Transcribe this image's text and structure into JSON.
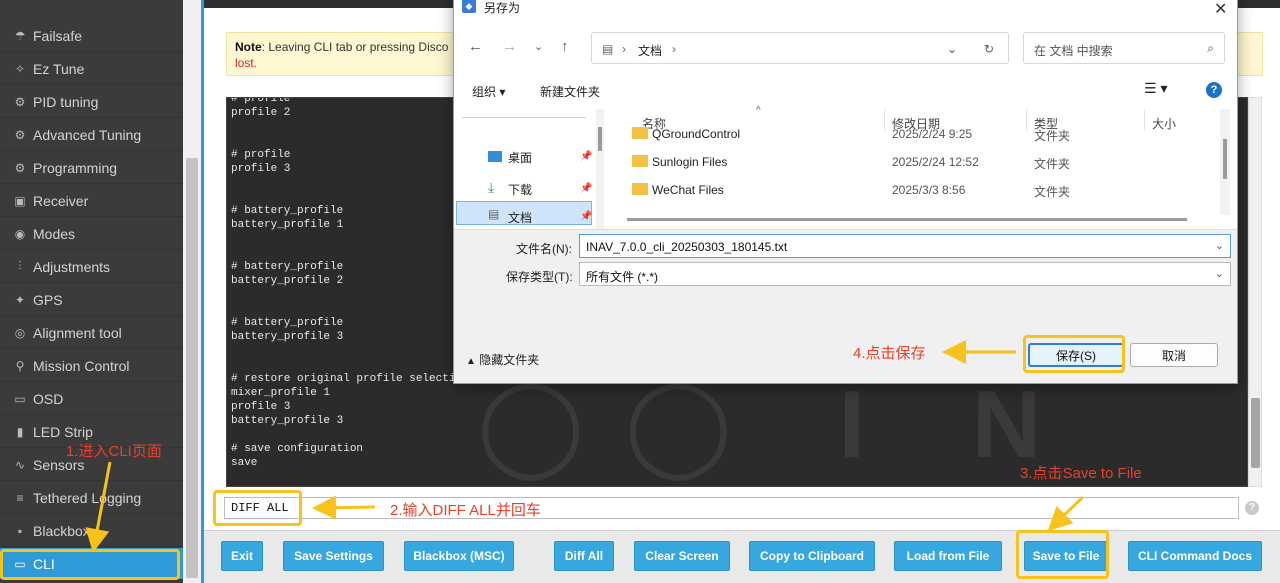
{
  "sidebar": {
    "items": [
      {
        "label": "Failsafe",
        "icon": "parachute-icon"
      },
      {
        "label": "Ez Tune",
        "icon": "magic-wand-icon"
      },
      {
        "label": "PID tuning",
        "icon": "pid-icon"
      },
      {
        "label": "Advanced Tuning",
        "icon": "advanced-tuning-icon"
      },
      {
        "label": "Programming",
        "icon": "gear-icon"
      },
      {
        "label": "Receiver",
        "icon": "receiver-icon"
      },
      {
        "label": "Modes",
        "icon": "toggle-icon"
      },
      {
        "label": "Adjustments",
        "icon": "sliders-icon"
      },
      {
        "label": "GPS",
        "icon": "satellite-icon"
      },
      {
        "label": "Alignment tool",
        "icon": "compass-icon"
      },
      {
        "label": "Mission Control",
        "icon": "map-pin-icon"
      },
      {
        "label": "OSD",
        "icon": "osd-icon"
      },
      {
        "label": "LED Strip",
        "icon": "led-icon"
      },
      {
        "label": "Sensors",
        "icon": "pulse-icon"
      },
      {
        "label": "Tethered Logging",
        "icon": "log-icon"
      },
      {
        "label": "Blackbox",
        "icon": "blackbox-icon"
      },
      {
        "label": "CLI",
        "icon": "terminal-icon"
      }
    ]
  },
  "note": {
    "bold": "Note",
    "text": ": Leaving CLI tab or pressing Disco",
    "lost": "lost."
  },
  "console": {
    "lines": [
      "# profile",
      "profile 2",
      "",
      "",
      "# profile",
      "profile 3",
      "",
      "",
      "# battery_profile",
      "battery_profile 1",
      "",
      "",
      "# battery_profile",
      "battery_profile 2",
      "",
      "",
      "# battery_profile",
      "battery_profile 3",
      "",
      "",
      "# restore original profile selection",
      "mixer_profile 1",
      "profile 3",
      "battery_profile 3",
      "",
      "# save configuration",
      "save"
    ]
  },
  "command_input": {
    "value": "DIFF ALL"
  },
  "buttons": {
    "exit": "Exit",
    "save_settings": "Save Settings",
    "blackbox_msc": "Blackbox (MSC)",
    "diff_all": "Diff All",
    "clear_screen": "Clear Screen",
    "copy_clipboard": "Copy to Clipboard",
    "load_file": "Load from File",
    "save_file": "Save to File",
    "cli_docs": "CLI Command Docs"
  },
  "dialog": {
    "title": "另存为",
    "path": "文档",
    "search_placeholder": "在 文档 中搜索",
    "organize": "组织 ▾",
    "new_folder": "新建文件夹",
    "nav": [
      {
        "label": "桌面"
      },
      {
        "label": "下载"
      },
      {
        "label": "文档"
      }
    ],
    "columns": {
      "name": "名称",
      "date": "修改日期",
      "type": "类型",
      "size": "大小"
    },
    "files": [
      {
        "name": "QGroundControl",
        "date": "2025/2/24 9:25",
        "type": "文件夹"
      },
      {
        "name": "Sunlogin Files",
        "date": "2025/2/24 12:52",
        "type": "文件夹"
      },
      {
        "name": "WeChat Files",
        "date": "2025/3/3 8:56",
        "type": "文件夹"
      }
    ],
    "filename_label": "文件名(N):",
    "filename_value": "INAV_7.0.0_cli_20250303_180145.txt",
    "filetype_label": "保存类型(T):",
    "filetype_value": "所有文件 (*.*)",
    "hide_folders": "隐藏文件夹",
    "save_button": "保存(S)",
    "cancel_button": "取消"
  },
  "annotations": {
    "step1": "1.进入CLI页面",
    "step2": "2.输入DIFF ALL并回车",
    "step3": "3.点击Save to File",
    "step4": "4.点击保存"
  },
  "colors": {
    "accent": "#2f9bd6",
    "highlight": "#f7c21b",
    "annotation": "#e8402a"
  }
}
